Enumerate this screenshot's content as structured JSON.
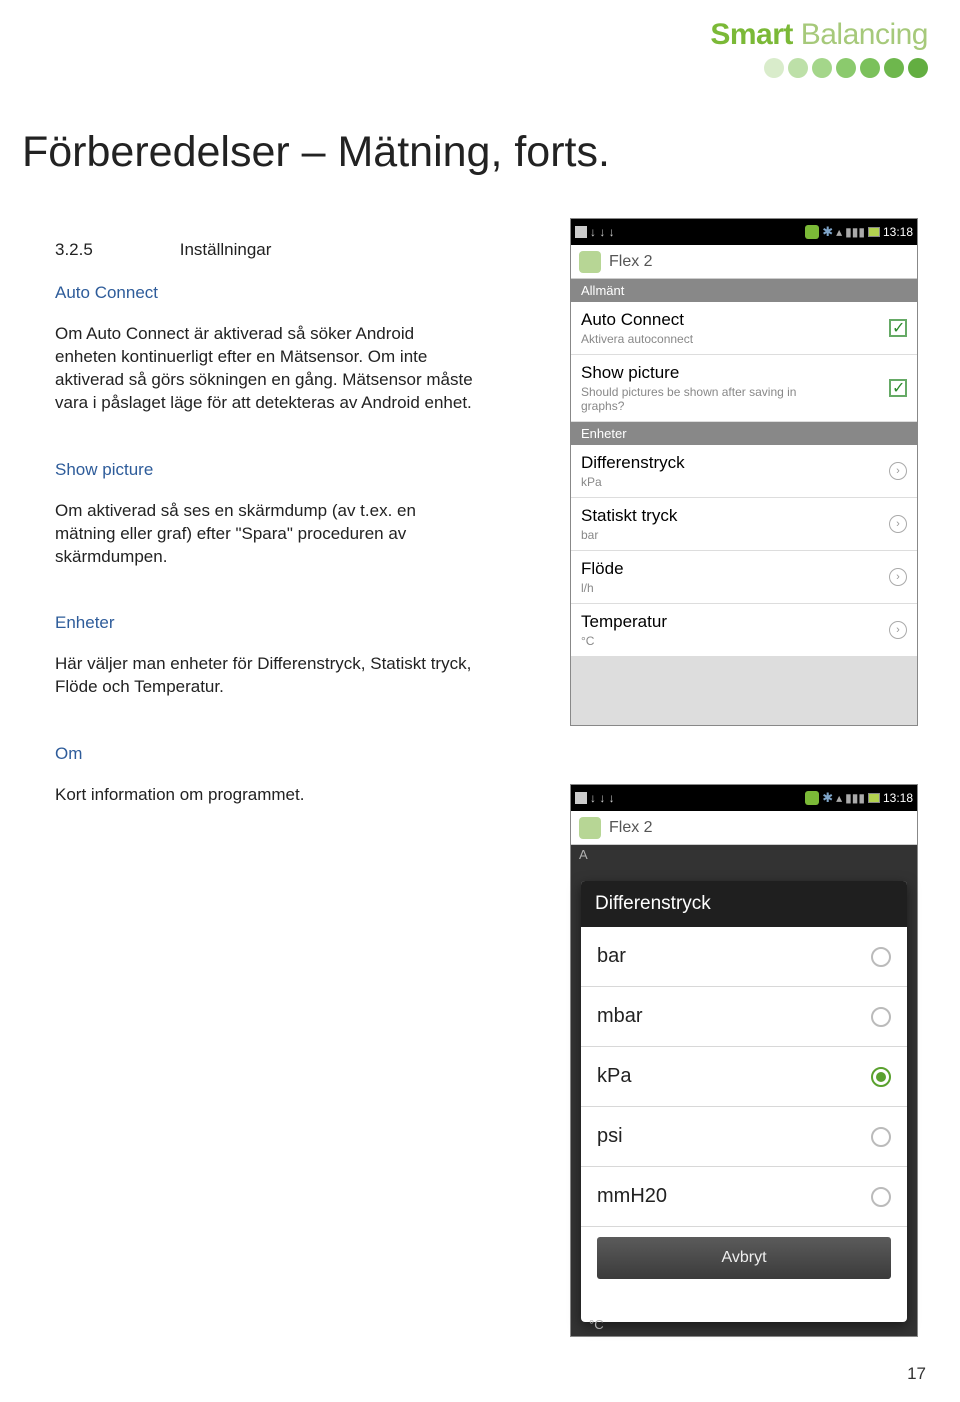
{
  "brand": {
    "bold": "Smart",
    "light": " Balancing"
  },
  "title": "Förberedelser – Mätning, forts.",
  "section_no": "3.2.5",
  "section_label": "Inställningar",
  "auto_connect": {
    "hdr": "Auto Connect",
    "body": "Om Auto Connect är aktiverad så söker Android enheten kontinuerligt efter en Mätsensor. Om inte aktiverad så görs sökningen en gång. Mätsensor måste vara i påslaget läge för att detekteras av Android enhet."
  },
  "show_picture": {
    "hdr": "Show picture",
    "body": "Om aktiverad så ses en skärmdump (av t.ex. en mätning eller graf) efter \"Spara\" proceduren av skärmdumpen."
  },
  "enheter": {
    "hdr": "Enheter",
    "body": "Här väljer man enheter för Differenstryck, Statiskt tryck, Flöde och Temperatur."
  },
  "om": {
    "hdr": "Om",
    "body": "Kort information om programmet."
  },
  "page_number": "17",
  "phone_time": "13:18",
  "app_title": "Flex 2",
  "ss1": {
    "hdr_general": "Allmänt",
    "auto_title": "Auto Connect",
    "auto_sub": "Aktivera autoconnect",
    "show_title": "Show picture",
    "show_sub": "Should pictures be shown after saving in graphs?",
    "hdr_units": "Enheter",
    "rows": [
      {
        "title": "Differenstryck",
        "sub": "kPa"
      },
      {
        "title": "Statiskt tryck",
        "sub": "bar"
      },
      {
        "title": "Flöde",
        "sub": "l/h"
      },
      {
        "title": "Temperatur",
        "sub": "°C"
      }
    ]
  },
  "ss2": {
    "dim_left": "A",
    "dialog_title": "Differenstryck",
    "options": [
      "bar",
      "mbar",
      "kPa",
      "psi",
      "mmH20"
    ],
    "selected_index": 2,
    "cancel": "Avbryt",
    "dim_bottom_sub": "°C"
  }
}
